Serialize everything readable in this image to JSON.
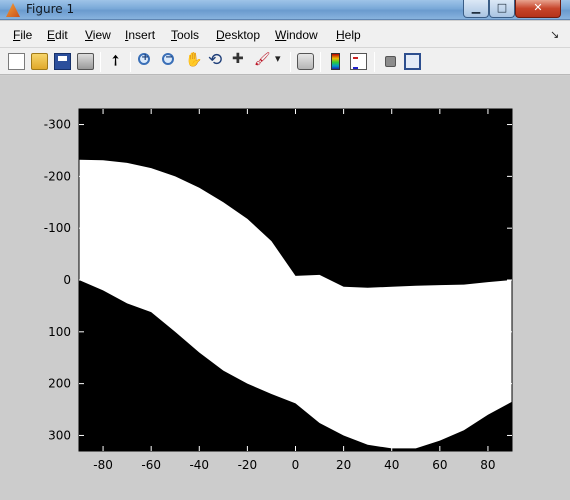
{
  "window": {
    "title": "Figure 1",
    "controls": {
      "minimize": "▁",
      "maximize": "□",
      "close": "✕"
    }
  },
  "menu": {
    "items": [
      "File",
      "Edit",
      "View",
      "Insert",
      "Tools",
      "Desktop",
      "Window",
      "Help"
    ],
    "overflow_arrow": "↘"
  },
  "toolbar": {
    "icons": [
      "new-figure-icon",
      "open-file-icon",
      "save-icon",
      "print-icon",
      "pointer-icon",
      "zoom-in-icon",
      "zoom-out-icon",
      "pan-icon",
      "rotate-3d-icon",
      "data-cursor-icon",
      "brush-icon",
      "dropdown-arrow-icon",
      "link-plot-icon",
      "colorbar-icon",
      "legend-icon",
      "hide-plot-tools-icon",
      "show-plot-tools-icon"
    ]
  },
  "chart_data": {
    "type": "heatmap",
    "colors": {
      "background": "#000000",
      "fill": "#ffffff",
      "figure": "#cccccc"
    },
    "xlim": [
      -90,
      90
    ],
    "ylim": [
      -330,
      330
    ],
    "y_reversed": true,
    "xticks": [
      -80,
      -60,
      -40,
      -20,
      0,
      20,
      40,
      60,
      80
    ],
    "yticks": [
      -300,
      -200,
      -100,
      0,
      100,
      200,
      300
    ],
    "title": "",
    "xlabel": "",
    "ylabel": "",
    "white_region": {
      "x": [
        -90,
        -80,
        -70,
        -60,
        -50,
        -40,
        -30,
        -20,
        -10,
        0,
        10,
        20,
        30,
        40,
        50,
        60,
        70,
        80,
        90
      ],
      "upper_y": [
        -232,
        -231,
        -226,
        -216,
        -200,
        -178,
        -150,
        -118,
        -75,
        -8,
        -10,
        13,
        15,
        13,
        11,
        10,
        9,
        4,
        0
      ],
      "lower_y": [
        0,
        20,
        45,
        62,
        100,
        140,
        175,
        200,
        220,
        238,
        276,
        300,
        318,
        325,
        325,
        310,
        290,
        260,
        235
      ]
    }
  }
}
